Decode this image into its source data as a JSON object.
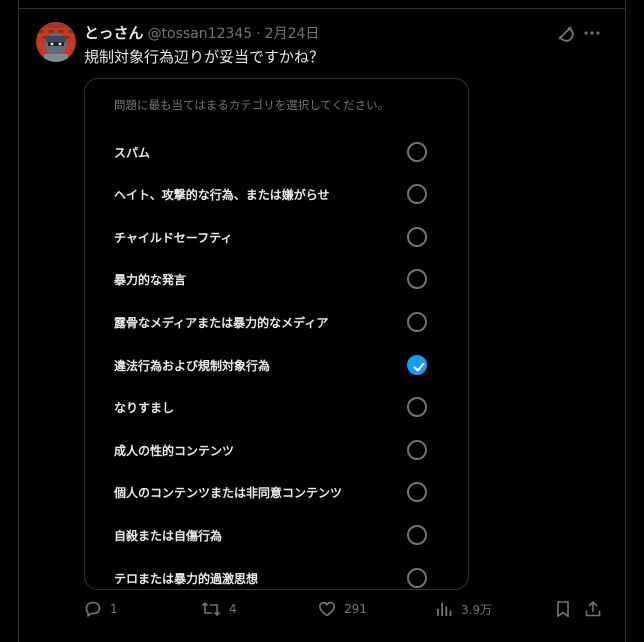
{
  "tweet": {
    "display_name": "とっさん",
    "handle": "@tossan12345",
    "separator": "·",
    "date": "2月24日",
    "text": "規制対象行為辺りが妥当ですかね？"
  },
  "report_card": {
    "prompt": "問題に最も当てはまるカテゴリを選択してください。",
    "options": [
      {
        "label": "スパム",
        "selected": false
      },
      {
        "label": "ヘイト、攻撃的な行為、または嫌がらせ",
        "selected": false
      },
      {
        "label": "チャイルドセーフティ",
        "selected": false
      },
      {
        "label": "暴力的な発言",
        "selected": false
      },
      {
        "label": "露骨なメディアまたは暴力的なメディア",
        "selected": false
      },
      {
        "label": "違法行為および規制対象行為",
        "selected": true
      },
      {
        "label": "なりすまし",
        "selected": false
      },
      {
        "label": "成人の性的コンテンツ",
        "selected": false
      },
      {
        "label": "個人のコンテンツまたは非同意コンテンツ",
        "selected": false
      },
      {
        "label": "自殺または自傷行為",
        "selected": false
      },
      {
        "label": "テロまたは暴力的過激思想",
        "selected": false
      }
    ]
  },
  "actions": {
    "reply_count": "1",
    "retweet_count": "4",
    "like_count": "291",
    "views_count": "3.9万"
  },
  "colors": {
    "background": "#000000",
    "text_primary": "#e7e9ea",
    "text_secondary": "#71767b",
    "border": "#2f3336",
    "accent": "#1d9bf0"
  },
  "icons": {
    "reply": "reply-icon",
    "retweet": "retweet-icon",
    "like": "heart-icon",
    "views": "views-icon",
    "bookmark": "bookmark-icon",
    "share": "share-icon",
    "grok": "grok-icon",
    "more": "more-icon"
  }
}
